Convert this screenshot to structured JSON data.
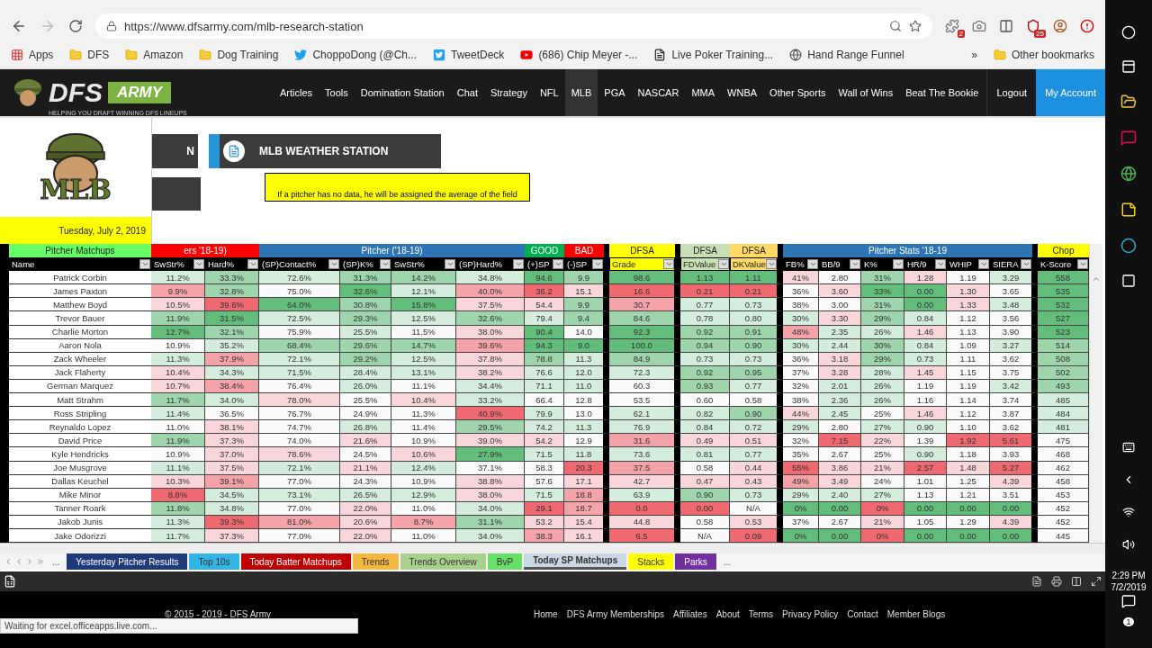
{
  "browser": {
    "url": "https://www.dfsarmy.com/mlb-research-station",
    "extensions": [
      {
        "kind": "puzzle",
        "badge": "2"
      },
      {
        "kind": "camera"
      },
      {
        "kind": "grid"
      },
      {
        "kind": "shield",
        "badge": "25"
      },
      {
        "kind": "avatar"
      },
      {
        "kind": "alert"
      }
    ],
    "bookmarks": [
      {
        "kind": "apps",
        "label": "Apps"
      },
      {
        "kind": "folder",
        "label": "DFS"
      },
      {
        "kind": "folder",
        "label": "Amazon"
      },
      {
        "kind": "folder",
        "label": "Dog Training"
      },
      {
        "kind": "twitter",
        "label": "ChoppoDong (@Ch..."
      },
      {
        "kind": "tweetdeck",
        "label": "TweetDeck"
      },
      {
        "kind": "youtube",
        "label": "(686) Chip Meyer -..."
      },
      {
        "kind": "page",
        "label": "Live Poker Training..."
      },
      {
        "kind": "globe",
        "label": "Hand Range Funnel"
      }
    ],
    "more": "»",
    "other_bookmarks": "Other bookmarks"
  },
  "site": {
    "logo": {
      "word1": "DFS",
      "word2": "ARMY",
      "tagline": "HELPING YOU DRAFT WINNING DFS LINEUPS"
    },
    "nav": [
      {
        "label": "Articles",
        "selected": false
      },
      {
        "label": "Tools",
        "selected": false
      },
      {
        "label": "Domination Station",
        "selected": false
      },
      {
        "label": "Chat",
        "selected": false
      },
      {
        "label": "Strategy",
        "selected": false
      },
      {
        "label": "NFL",
        "selected": false
      },
      {
        "label": "MLB",
        "selected": true
      },
      {
        "label": "PGA",
        "selected": false
      },
      {
        "label": "NASCAR",
        "selected": false
      },
      {
        "label": "MMA",
        "selected": false
      },
      {
        "label": "WNBA",
        "selected": false
      },
      {
        "label": "Other Sports",
        "selected": false
      },
      {
        "label": "Wall of Wins",
        "selected": false
      },
      {
        "label": "Beat The Bookie",
        "selected": false
      }
    ],
    "logout": "Logout",
    "account": "My Account"
  },
  "sheet": {
    "logo_text": "MLB",
    "date": "Tuesday, July 2, 2019",
    "cut_button": "N",
    "weather_button": "MLB WEATHER STATION",
    "note": "If a pitcher has no data, he will be assigned the average of the field",
    "column_groups": [
      {
        "label": "Pitcher Matchups",
        "color": "#66ff66",
        "divider_after": false,
        "columns": [
          {
            "label": "Name"
          }
        ]
      },
      {
        "label": "ers '18-19)",
        "color": "#ff0000",
        "divider_after": false,
        "columns": [
          {
            "label": "SwStr%"
          },
          {
            "label": "Hard%"
          }
        ]
      },
      {
        "label": "Pitcher ('18-19)",
        "color": "#2e75b6",
        "divider_after": false,
        "columns": [
          {
            "label": "(SP)Contact%"
          },
          {
            "label": "(SP)K%"
          },
          {
            "label": "SwStr%"
          },
          {
            "label": "(SP)Hard%"
          }
        ]
      },
      {
        "label": "GOOD",
        "color": "#00b050",
        "divider_after": false,
        "columns": [
          {
            "label": "(+)SP"
          }
        ]
      },
      {
        "label": "BAD",
        "color": "#ff0000",
        "divider_after": true,
        "columns": [
          {
            "label": "(-)SP"
          }
        ]
      },
      {
        "label": "DFSA",
        "color": "#ffff00",
        "divider_after": true,
        "columns": [
          {
            "label": "Grade",
            "color": "#ffff00"
          }
        ]
      },
      {
        "label": "DFSA",
        "color": "#c6e0b4",
        "divider_after": false,
        "columns": [
          {
            "label": "FDValue",
            "color": "#c6e0b4"
          }
        ]
      },
      {
        "label": "DFSA",
        "color": "#ffd966",
        "divider_after": true,
        "columns": [
          {
            "label": "DKValue",
            "color": "#ffd966"
          }
        ]
      },
      {
        "label": "Pitcher Stats '18-19",
        "color": "#2e75b6",
        "divider_after": true,
        "columns": [
          {
            "label": "FB%"
          },
          {
            "label": "BB/9"
          },
          {
            "label": "K%"
          },
          {
            "label": "HR/9"
          },
          {
            "label": "WHIP"
          },
          {
            "label": "SIERA"
          }
        ]
      },
      {
        "label": "Chop",
        "color": "#ffff00",
        "divider_after": false,
        "columns": [
          {
            "label": "K-Score"
          }
        ]
      }
    ],
    "rows": [
      {
        "name": "Patrick Corbin",
        "cells": [
          {
            "text": "11.2%",
            "color": "#d5eddc"
          },
          {
            "text": "33.3%",
            "color": "#9ed5ac"
          },
          {
            "text": "72.6%",
            "color": "#d5eddc"
          },
          {
            "text": "31.3%",
            "color": "#9ed5ac"
          },
          {
            "text": "14.2%",
            "color": "#9ed5ac"
          },
          {
            "text": "34.8%",
            "color": "#d5eddc"
          },
          {
            "text": "94.6",
            "color": "#63be7b"
          },
          {
            "text": "9.9",
            "color": "#9ed5ac"
          },
          {
            "text": "98.6",
            "color": "#63be7b"
          },
          {
            "text": "1.13",
            "color": "#63be7b"
          },
          {
            "text": "1.11",
            "color": "#63be7b"
          },
          {
            "text": "41%",
            "color": "#f9d6d9"
          },
          {
            "text": "2.80",
            "color": "#fafafa"
          },
          {
            "text": "31%",
            "color": "#9ed5ac"
          },
          {
            "text": "1.28",
            "color": "#f9d6d9"
          },
          {
            "text": "1.19",
            "color": "#fafafa"
          },
          {
            "text": "3.29",
            "color": "#d5eddc"
          },
          {
            "text": "558",
            "color": "#63be7b"
          }
        ]
      },
      {
        "name": "James Paxton",
        "cells": [
          {
            "text": "9.9%",
            "color": "#f4a3a8"
          },
          {
            "text": "32.8%",
            "color": "#9ed5ac"
          },
          {
            "text": "75.0%",
            "color": "#fafafa"
          },
          {
            "text": "32.6%",
            "color": "#63be7b"
          },
          {
            "text": "12.1%",
            "color": "#d5eddc"
          },
          {
            "text": "40.0%",
            "color": "#f4a3a8"
          },
          {
            "text": "36.2",
            "color": "#ee6a70"
          },
          {
            "text": "15.1",
            "color": "#f9d6d9"
          },
          {
            "text": "16.6",
            "color": "#ee6a70"
          },
          {
            "text": "0.21",
            "color": "#ee6a70"
          },
          {
            "text": "0.21",
            "color": "#ee6a70"
          },
          {
            "text": "36%",
            "color": "#fafafa"
          },
          {
            "text": "3.60",
            "color": "#f9d6d9"
          },
          {
            "text": "33%",
            "color": "#63be7b"
          },
          {
            "text": "0.00",
            "color": "#63be7b"
          },
          {
            "text": "1.30",
            "color": "#f9d6d9"
          },
          {
            "text": "3.65",
            "color": "#fafafa"
          },
          {
            "text": "535",
            "color": "#63be7b"
          }
        ]
      },
      {
        "name": "Matthew Boyd",
        "cells": [
          {
            "text": "10.5%",
            "color": "#f9d6d9"
          },
          {
            "text": "39.6%",
            "color": "#ee6a70"
          },
          {
            "text": "64.0%",
            "color": "#63be7b"
          },
          {
            "text": "30.8%",
            "color": "#9ed5ac"
          },
          {
            "text": "15.8%",
            "color": "#63be7b"
          },
          {
            "text": "37.5%",
            "color": "#f9d6d9"
          },
          {
            "text": "54.4",
            "color": "#f9d6d9"
          },
          {
            "text": "9.9",
            "color": "#9ed5ac"
          },
          {
            "text": "30.7",
            "color": "#f4a3a8"
          },
          {
            "text": "0.77",
            "color": "#d5eddc"
          },
          {
            "text": "0.73",
            "color": "#d5eddc"
          },
          {
            "text": "38%",
            "color": "#fafafa"
          },
          {
            "text": "3.00",
            "color": "#fafafa"
          },
          {
            "text": "31%",
            "color": "#9ed5ac"
          },
          {
            "text": "0.00",
            "color": "#63be7b"
          },
          {
            "text": "1.33",
            "color": "#f9d6d9"
          },
          {
            "text": "3.48",
            "color": "#d5eddc"
          },
          {
            "text": "532",
            "color": "#63be7b"
          }
        ]
      },
      {
        "name": "Trevor Bauer",
        "cells": [
          {
            "text": "11.9%",
            "color": "#9ed5ac"
          },
          {
            "text": "31.5%",
            "color": "#63be7b"
          },
          {
            "text": "72.5%",
            "color": "#d5eddc"
          },
          {
            "text": "29.3%",
            "color": "#9ed5ac"
          },
          {
            "text": "12.5%",
            "color": "#d5eddc"
          },
          {
            "text": "32.6%",
            "color": "#9ed5ac"
          },
          {
            "text": "79.4",
            "color": "#d5eddc"
          },
          {
            "text": "9.4",
            "color": "#9ed5ac"
          },
          {
            "text": "84.6",
            "color": "#9ed5ac"
          },
          {
            "text": "0.78",
            "color": "#d5eddc"
          },
          {
            "text": "0.80",
            "color": "#d5eddc"
          },
          {
            "text": "30%",
            "color": "#d5eddc"
          },
          {
            "text": "3.30",
            "color": "#f9d6d9"
          },
          {
            "text": "29%",
            "color": "#9ed5ac"
          },
          {
            "text": "0.84",
            "color": "#d5eddc"
          },
          {
            "text": "1.12",
            "color": "#fafafa"
          },
          {
            "text": "3.56",
            "color": "#fafafa"
          },
          {
            "text": "527",
            "color": "#63be7b"
          }
        ]
      },
      {
        "name": "Charlie Morton",
        "cells": [
          {
            "text": "12.7%",
            "color": "#63be7b"
          },
          {
            "text": "32.1%",
            "color": "#9ed5ac"
          },
          {
            "text": "75.9%",
            "color": "#fafafa"
          },
          {
            "text": "25.5%",
            "color": "#d5eddc"
          },
          {
            "text": "11.5%",
            "color": "#fafafa"
          },
          {
            "text": "38.0%",
            "color": "#f9d6d9"
          },
          {
            "text": "90.4",
            "color": "#63be7b"
          },
          {
            "text": "14.0",
            "color": "#fafafa"
          },
          {
            "text": "92.3",
            "color": "#63be7b"
          },
          {
            "text": "0.92",
            "color": "#9ed5ac"
          },
          {
            "text": "0.91",
            "color": "#9ed5ac"
          },
          {
            "text": "48%",
            "color": "#f4a3a8"
          },
          {
            "text": "2.35",
            "color": "#d5eddc"
          },
          {
            "text": "26%",
            "color": "#d5eddc"
          },
          {
            "text": "1.46",
            "color": "#f9d6d9"
          },
          {
            "text": "1.13",
            "color": "#fafafa"
          },
          {
            "text": "3.90",
            "color": "#fafafa"
          },
          {
            "text": "523",
            "color": "#63be7b"
          }
        ]
      },
      {
        "name": "Aaron Nola",
        "cells": [
          {
            "text": "10.9%",
            "color": "#fafafa"
          },
          {
            "text": "35.2%",
            "color": "#d5eddc"
          },
          {
            "text": "68.4%",
            "color": "#9ed5ac"
          },
          {
            "text": "29.6%",
            "color": "#9ed5ac"
          },
          {
            "text": "14.7%",
            "color": "#9ed5ac"
          },
          {
            "text": "39.6%",
            "color": "#f4a3a8"
          },
          {
            "text": "94.3",
            "color": "#63be7b"
          },
          {
            "text": "9.0",
            "color": "#63be7b"
          },
          {
            "text": "100.0",
            "color": "#63be7b"
          },
          {
            "text": "0.94",
            "color": "#9ed5ac"
          },
          {
            "text": "0.90",
            "color": "#9ed5ac"
          },
          {
            "text": "30%",
            "color": "#d5eddc"
          },
          {
            "text": "2.44",
            "color": "#d5eddc"
          },
          {
            "text": "30%",
            "color": "#9ed5ac"
          },
          {
            "text": "0.84",
            "color": "#d5eddc"
          },
          {
            "text": "1.09",
            "color": "#fafafa"
          },
          {
            "text": "3.27",
            "color": "#d5eddc"
          },
          {
            "text": "514",
            "color": "#9ed5ac"
          }
        ]
      },
      {
        "name": "Zack Wheeler",
        "cells": [
          {
            "text": "11.3%",
            "color": "#d5eddc"
          },
          {
            "text": "37.9%",
            "color": "#f4a3a8"
          },
          {
            "text": "72.1%",
            "color": "#d5eddc"
          },
          {
            "text": "29.2%",
            "color": "#9ed5ac"
          },
          {
            "text": "12.5%",
            "color": "#d5eddc"
          },
          {
            "text": "37.8%",
            "color": "#f9d6d9"
          },
          {
            "text": "78.8",
            "color": "#9ed5ac"
          },
          {
            "text": "11.3",
            "color": "#d5eddc"
          },
          {
            "text": "84.9",
            "color": "#9ed5ac"
          },
          {
            "text": "0.73",
            "color": "#d5eddc"
          },
          {
            "text": "0.73",
            "color": "#d5eddc"
          },
          {
            "text": "36%",
            "color": "#fafafa"
          },
          {
            "text": "3.18",
            "color": "#f9d6d9"
          },
          {
            "text": "29%",
            "color": "#9ed5ac"
          },
          {
            "text": "0.73",
            "color": "#d5eddc"
          },
          {
            "text": "1.11",
            "color": "#fafafa"
          },
          {
            "text": "3.62",
            "color": "#fafafa"
          },
          {
            "text": "508",
            "color": "#9ed5ac"
          }
        ]
      },
      {
        "name": "Jack Flaherty",
        "cells": [
          {
            "text": "10.4%",
            "color": "#f9d6d9"
          },
          {
            "text": "34.3%",
            "color": "#d5eddc"
          },
          {
            "text": "71.5%",
            "color": "#d5eddc"
          },
          {
            "text": "28.4%",
            "color": "#d5eddc"
          },
          {
            "text": "13.1%",
            "color": "#d5eddc"
          },
          {
            "text": "38.2%",
            "color": "#f9d6d9"
          },
          {
            "text": "76.6",
            "color": "#d5eddc"
          },
          {
            "text": "12.0",
            "color": "#d5eddc"
          },
          {
            "text": "72.3",
            "color": "#d5eddc"
          },
          {
            "text": "0.92",
            "color": "#9ed5ac"
          },
          {
            "text": "0.95",
            "color": "#9ed5ac"
          },
          {
            "text": "37%",
            "color": "#fafafa"
          },
          {
            "text": "3.28",
            "color": "#f9d6d9"
          },
          {
            "text": "28%",
            "color": "#d5eddc"
          },
          {
            "text": "1.45",
            "color": "#f9d6d9"
          },
          {
            "text": "1.15",
            "color": "#fafafa"
          },
          {
            "text": "3.75",
            "color": "#fafafa"
          },
          {
            "text": "502",
            "color": "#9ed5ac"
          }
        ]
      },
      {
        "name": "German Marquez",
        "cells": [
          {
            "text": "10.7%",
            "color": "#f9d6d9"
          },
          {
            "text": "38.4%",
            "color": "#f4a3a8"
          },
          {
            "text": "76.4%",
            "color": "#fafafa"
          },
          {
            "text": "26.0%",
            "color": "#d5eddc"
          },
          {
            "text": "11.1%",
            "color": "#fafafa"
          },
          {
            "text": "34.4%",
            "color": "#d5eddc"
          },
          {
            "text": "71.1",
            "color": "#d5eddc"
          },
          {
            "text": "11.0",
            "color": "#d5eddc"
          },
          {
            "text": "60.3",
            "color": "#fafafa"
          },
          {
            "text": "0.93",
            "color": "#9ed5ac"
          },
          {
            "text": "0.77",
            "color": "#d5eddc"
          },
          {
            "text": "32%",
            "color": "#fafafa"
          },
          {
            "text": "2.01",
            "color": "#d5eddc"
          },
          {
            "text": "26%",
            "color": "#d5eddc"
          },
          {
            "text": "1.19",
            "color": "#fafafa"
          },
          {
            "text": "1.19",
            "color": "#fafafa"
          },
          {
            "text": "3.42",
            "color": "#d5eddc"
          },
          {
            "text": "493",
            "color": "#9ed5ac"
          }
        ]
      },
      {
        "name": "Matt Strahm",
        "cells": [
          {
            "text": "11.7%",
            "color": "#9ed5ac"
          },
          {
            "text": "34.0%",
            "color": "#d5eddc"
          },
          {
            "text": "78.0%",
            "color": "#f9d6d9"
          },
          {
            "text": "25.5%",
            "color": "#fafafa"
          },
          {
            "text": "10.4%",
            "color": "#f9d6d9"
          },
          {
            "text": "33.2%",
            "color": "#d5eddc"
          },
          {
            "text": "66.4",
            "color": "#fafafa"
          },
          {
            "text": "12.8",
            "color": "#fafafa"
          },
          {
            "text": "53.5",
            "color": "#fafafa"
          },
          {
            "text": "0.60",
            "color": "#fafafa"
          },
          {
            "text": "0.58",
            "color": "#fafafa"
          },
          {
            "text": "38%",
            "color": "#fafafa"
          },
          {
            "text": "2.36",
            "color": "#d5eddc"
          },
          {
            "text": "26%",
            "color": "#d5eddc"
          },
          {
            "text": "1.16",
            "color": "#fafafa"
          },
          {
            "text": "1.14",
            "color": "#fafafa"
          },
          {
            "text": "3.74",
            "color": "#fafafa"
          },
          {
            "text": "485",
            "color": "#d5eddc"
          }
        ]
      },
      {
        "name": "Ross Stripling",
        "cells": [
          {
            "text": "11.4%",
            "color": "#d5eddc"
          },
          {
            "text": "36.5%",
            "color": "#fafafa"
          },
          {
            "text": "76.7%",
            "color": "#fafafa"
          },
          {
            "text": "24.9%",
            "color": "#fafafa"
          },
          {
            "text": "11.3%",
            "color": "#fafafa"
          },
          {
            "text": "40.9%",
            "color": "#ee6a70"
          },
          {
            "text": "79.9",
            "color": "#d5eddc"
          },
          {
            "text": "13.0",
            "color": "#fafafa"
          },
          {
            "text": "62.1",
            "color": "#d5eddc"
          },
          {
            "text": "0.82",
            "color": "#d5eddc"
          },
          {
            "text": "0.90",
            "color": "#9ed5ac"
          },
          {
            "text": "44%",
            "color": "#f9d6d9"
          },
          {
            "text": "2.45",
            "color": "#d5eddc"
          },
          {
            "text": "25%",
            "color": "#fafafa"
          },
          {
            "text": "1.46",
            "color": "#f9d6d9"
          },
          {
            "text": "1.12",
            "color": "#fafafa"
          },
          {
            "text": "3.87",
            "color": "#fafafa"
          },
          {
            "text": "484",
            "color": "#d5eddc"
          }
        ]
      },
      {
        "name": "Reynaldo Lopez",
        "cells": [
          {
            "text": "11.0%",
            "color": "#fafafa"
          },
          {
            "text": "38.1%",
            "color": "#f9d6d9"
          },
          {
            "text": "74.7%",
            "color": "#fafafa"
          },
          {
            "text": "26.8%",
            "color": "#d5eddc"
          },
          {
            "text": "11.4%",
            "color": "#fafafa"
          },
          {
            "text": "29.5%",
            "color": "#9ed5ac"
          },
          {
            "text": "74.2",
            "color": "#d5eddc"
          },
          {
            "text": "11.3",
            "color": "#d5eddc"
          },
          {
            "text": "76.9",
            "color": "#d5eddc"
          },
          {
            "text": "0.84",
            "color": "#d5eddc"
          },
          {
            "text": "0.72",
            "color": "#d5eddc"
          },
          {
            "text": "29%",
            "color": "#d5eddc"
          },
          {
            "text": "2.80",
            "color": "#fafafa"
          },
          {
            "text": "27%",
            "color": "#d5eddc"
          },
          {
            "text": "0.90",
            "color": "#d5eddc"
          },
          {
            "text": "1.10",
            "color": "#fafafa"
          },
          {
            "text": "3.62",
            "color": "#fafafa"
          },
          {
            "text": "481",
            "color": "#d5eddc"
          }
        ]
      },
      {
        "name": "David Price",
        "cells": [
          {
            "text": "11.9%",
            "color": "#9ed5ac"
          },
          {
            "text": "37.3%",
            "color": "#f9d6d9"
          },
          {
            "text": "74.0%",
            "color": "#fafafa"
          },
          {
            "text": "21.6%",
            "color": "#f9d6d9"
          },
          {
            "text": "10.9%",
            "color": "#fafafa"
          },
          {
            "text": "39.0%",
            "color": "#f9d6d9"
          },
          {
            "text": "54.2",
            "color": "#f9d6d9"
          },
          {
            "text": "12.9",
            "color": "#fafafa"
          },
          {
            "text": "31.6",
            "color": "#f4a3a8"
          },
          {
            "text": "0.49",
            "color": "#f9d6d9"
          },
          {
            "text": "0.51",
            "color": "#f9d6d9"
          },
          {
            "text": "32%",
            "color": "#fafafa"
          },
          {
            "text": "7.15",
            "color": "#ee6a70"
          },
          {
            "text": "22%",
            "color": "#f9d6d9"
          },
          {
            "text": "1.39",
            "color": "#fafafa"
          },
          {
            "text": "1.92",
            "color": "#ee6a70"
          },
          {
            "text": "5.61",
            "color": "#ee6a70"
          },
          {
            "text": "475",
            "color": "#fafafa"
          }
        ]
      },
      {
        "name": "Kyle Hendricks",
        "cells": [
          {
            "text": "10.9%",
            "color": "#fafafa"
          },
          {
            "text": "37.0%",
            "color": "#f9d6d9"
          },
          {
            "text": "78.6%",
            "color": "#f9d6d9"
          },
          {
            "text": "24.5%",
            "color": "#fafafa"
          },
          {
            "text": "10.6%",
            "color": "#f9d6d9"
          },
          {
            "text": "27.9%",
            "color": "#63be7b"
          },
          {
            "text": "71.5",
            "color": "#d5eddc"
          },
          {
            "text": "11.8",
            "color": "#d5eddc"
          },
          {
            "text": "73.6",
            "color": "#d5eddc"
          },
          {
            "text": "0.81",
            "color": "#d5eddc"
          },
          {
            "text": "0.77",
            "color": "#d5eddc"
          },
          {
            "text": "35%",
            "color": "#fafafa"
          },
          {
            "text": "2.67",
            "color": "#fafafa"
          },
          {
            "text": "25%",
            "color": "#fafafa"
          },
          {
            "text": "0.90",
            "color": "#d5eddc"
          },
          {
            "text": "1.18",
            "color": "#fafafa"
          },
          {
            "text": "3.93",
            "color": "#fafafa"
          },
          {
            "text": "468",
            "color": "#fafafa"
          }
        ]
      },
      {
        "name": "Joe Musgrove",
        "cells": [
          {
            "text": "11.1%",
            "color": "#d5eddc"
          },
          {
            "text": "37.5%",
            "color": "#f9d6d9"
          },
          {
            "text": "72.1%",
            "color": "#d5eddc"
          },
          {
            "text": "21.1%",
            "color": "#f9d6d9"
          },
          {
            "text": "12.4%",
            "color": "#d5eddc"
          },
          {
            "text": "37.1%",
            "color": "#fafafa"
          },
          {
            "text": "58.3",
            "color": "#fafafa"
          },
          {
            "text": "20.3",
            "color": "#ee6a70"
          },
          {
            "text": "37.5",
            "color": "#f4a3a8"
          },
          {
            "text": "0.58",
            "color": "#fafafa"
          },
          {
            "text": "0.44",
            "color": "#f9d6d9"
          },
          {
            "text": "55%",
            "color": "#ee6a70"
          },
          {
            "text": "3.86",
            "color": "#f9d6d9"
          },
          {
            "text": "21%",
            "color": "#f9d6d9"
          },
          {
            "text": "2.57",
            "color": "#ee6a70"
          },
          {
            "text": "1.48",
            "color": "#f9d6d9"
          },
          {
            "text": "5.27",
            "color": "#ee6a70"
          },
          {
            "text": "462",
            "color": "#fafafa"
          }
        ]
      },
      {
        "name": "Dallas Keuchel",
        "cells": [
          {
            "text": "10.3%",
            "color": "#f9d6d9"
          },
          {
            "text": "39.1%",
            "color": "#f4a3a8"
          },
          {
            "text": "77.0%",
            "color": "#fafafa"
          },
          {
            "text": "24.3%",
            "color": "#fafafa"
          },
          {
            "text": "10.9%",
            "color": "#fafafa"
          },
          {
            "text": "38.8%",
            "color": "#f9d6d9"
          },
          {
            "text": "57.6",
            "color": "#fafafa"
          },
          {
            "text": "17.1",
            "color": "#f9d6d9"
          },
          {
            "text": "42.7",
            "color": "#f9d6d9"
          },
          {
            "text": "0.47",
            "color": "#f9d6d9"
          },
          {
            "text": "0.43",
            "color": "#f9d6d9"
          },
          {
            "text": "49%",
            "color": "#f4a3a8"
          },
          {
            "text": "3.49",
            "color": "#f9d6d9"
          },
          {
            "text": "24%",
            "color": "#fafafa"
          },
          {
            "text": "1.01",
            "color": "#fafafa"
          },
          {
            "text": "1.25",
            "color": "#fafafa"
          },
          {
            "text": "4.39",
            "color": "#f9d6d9"
          },
          {
            "text": "458",
            "color": "#fafafa"
          }
        ]
      },
      {
        "name": "Mike Minor",
        "cells": [
          {
            "text": "8.8%",
            "color": "#ee6a70"
          },
          {
            "text": "34.5%",
            "color": "#d5eddc"
          },
          {
            "text": "73.1%",
            "color": "#d5eddc"
          },
          {
            "text": "26.5%",
            "color": "#d5eddc"
          },
          {
            "text": "12.9%",
            "color": "#d5eddc"
          },
          {
            "text": "38.0%",
            "color": "#f9d6d9"
          },
          {
            "text": "71.5",
            "color": "#d5eddc"
          },
          {
            "text": "18.8",
            "color": "#f4a3a8"
          },
          {
            "text": "63.9",
            "color": "#d5eddc"
          },
          {
            "text": "0.90",
            "color": "#9ed5ac"
          },
          {
            "text": "0.73",
            "color": "#d5eddc"
          },
          {
            "text": "29%",
            "color": "#d5eddc"
          },
          {
            "text": "2.40",
            "color": "#d5eddc"
          },
          {
            "text": "27%",
            "color": "#d5eddc"
          },
          {
            "text": "1.13",
            "color": "#fafafa"
          },
          {
            "text": "1.21",
            "color": "#fafafa"
          },
          {
            "text": "3.51",
            "color": "#fafafa"
          },
          {
            "text": "453",
            "color": "#fafafa"
          }
        ]
      },
      {
        "name": "Tanner Roark",
        "cells": [
          {
            "text": "11.8%",
            "color": "#9ed5ac"
          },
          {
            "text": "34.8%",
            "color": "#d5eddc"
          },
          {
            "text": "77.0%",
            "color": "#fafafa"
          },
          {
            "text": "22.0%",
            "color": "#f9d6d9"
          },
          {
            "text": "11.0%",
            "color": "#fafafa"
          },
          {
            "text": "34.0%",
            "color": "#d5eddc"
          },
          {
            "text": "29.1",
            "color": "#ee6a70"
          },
          {
            "text": "18.7",
            "color": "#f4a3a8"
          },
          {
            "text": "0.0",
            "color": "#ee6a70"
          },
          {
            "text": "0.00",
            "color": "#ee6a70"
          },
          {
            "text": "N/A",
            "color": "#fafafa"
          },
          {
            "text": "0%",
            "color": "#63be7b"
          },
          {
            "text": "0.00",
            "color": "#63be7b"
          },
          {
            "text": "0%",
            "color": "#ee6a70"
          },
          {
            "text": "0.00",
            "color": "#63be7b"
          },
          {
            "text": "0.00",
            "color": "#63be7b"
          },
          {
            "text": "0.00",
            "color": "#63be7b"
          },
          {
            "text": "452",
            "color": "#fafafa"
          }
        ]
      },
      {
        "name": "Jakob Junis",
        "cells": [
          {
            "text": "11.3%",
            "color": "#d5eddc"
          },
          {
            "text": "39.3%",
            "color": "#ee6a70"
          },
          {
            "text": "81.0%",
            "color": "#f4a3a8"
          },
          {
            "text": "20.6%",
            "color": "#f9d6d9"
          },
          {
            "text": "8.7%",
            "color": "#f4a3a8"
          },
          {
            "text": "31.1%",
            "color": "#9ed5ac"
          },
          {
            "text": "53.2",
            "color": "#f9d6d9"
          },
          {
            "text": "15.4",
            "color": "#f9d6d9"
          },
          {
            "text": "44.8",
            "color": "#f9d6d9"
          },
          {
            "text": "0.58",
            "color": "#fafafa"
          },
          {
            "text": "0.53",
            "color": "#f9d6d9"
          },
          {
            "text": "37%",
            "color": "#fafafa"
          },
          {
            "text": "2.67",
            "color": "#fafafa"
          },
          {
            "text": "21%",
            "color": "#f9d6d9"
          },
          {
            "text": "1.05",
            "color": "#fafafa"
          },
          {
            "text": "1.29",
            "color": "#fafafa"
          },
          {
            "text": "4.39",
            "color": "#f9d6d9"
          },
          {
            "text": "452",
            "color": "#fafafa"
          }
        ]
      },
      {
        "name": "Jake Odorizzi",
        "cells": [
          {
            "text": "11.7%",
            "color": "#d5eddc"
          },
          {
            "text": "37.3%",
            "color": "#f9d6d9"
          },
          {
            "text": "77.0%",
            "color": "#fafafa"
          },
          {
            "text": "22.0%",
            "color": "#f9d6d9"
          },
          {
            "text": "11.0%",
            "color": "#fafafa"
          },
          {
            "text": "34.0%",
            "color": "#d5eddc"
          },
          {
            "text": "38.3",
            "color": "#f4a3a8"
          },
          {
            "text": "16.1",
            "color": "#f9d6d9"
          },
          {
            "text": "6.5",
            "color": "#ee6a70"
          },
          {
            "text": "N/A",
            "color": "#fafafa"
          },
          {
            "text": "0.09",
            "color": "#ee6a70"
          },
          {
            "text": "0%",
            "color": "#63be7b"
          },
          {
            "text": "0.00",
            "color": "#63be7b"
          },
          {
            "text": "0%",
            "color": "#ee6a70"
          },
          {
            "text": "0.00",
            "color": "#63be7b"
          },
          {
            "text": "0.00",
            "color": "#63be7b"
          },
          {
            "text": "0.00",
            "color": "#63be7b"
          },
          {
            "text": "445",
            "color": "#fafafa"
          }
        ]
      }
    ],
    "tabs_more_left": "...",
    "tabs_more_right": "...",
    "sheet_tabs": [
      {
        "label": "Yesterday Pitcher Results",
        "color": "#1f3a7a",
        "selected": false
      },
      {
        "label": "Top 10s",
        "color": "#33b5e5",
        "selected": false
      },
      {
        "label": "Today Batter Matchups",
        "color": "#c00000",
        "selected": false
      },
      {
        "label": "Trends",
        "color": "#f4b73f",
        "selected": false
      },
      {
        "label": "Trends Overview",
        "color": "#a9d18e",
        "selected": false
      },
      {
        "label": "BvP",
        "color": "#66e066",
        "selected": false
      },
      {
        "label": "Today SP Matchups",
        "color": "#c9d6e3",
        "selected": true
      },
      {
        "label": "Stacks",
        "color": "#ffff00",
        "selected": false
      },
      {
        "label": "Parks",
        "color": "#7030a0",
        "selected": false
      }
    ]
  },
  "footer": {
    "copyright": "© 2015 - 2019 - DFS Army",
    "links": [
      "Home",
      "DFS Army Memberships",
      "Affiliates",
      "About",
      "Terms",
      "Privacy Policy",
      "Contact",
      "Member Blogs"
    ]
  },
  "status": "Waiting for excel.officeapps.live.com...",
  "taskbar": {
    "time": "2:29 PM",
    "date": "7/2/2019",
    "notifications": "1"
  }
}
